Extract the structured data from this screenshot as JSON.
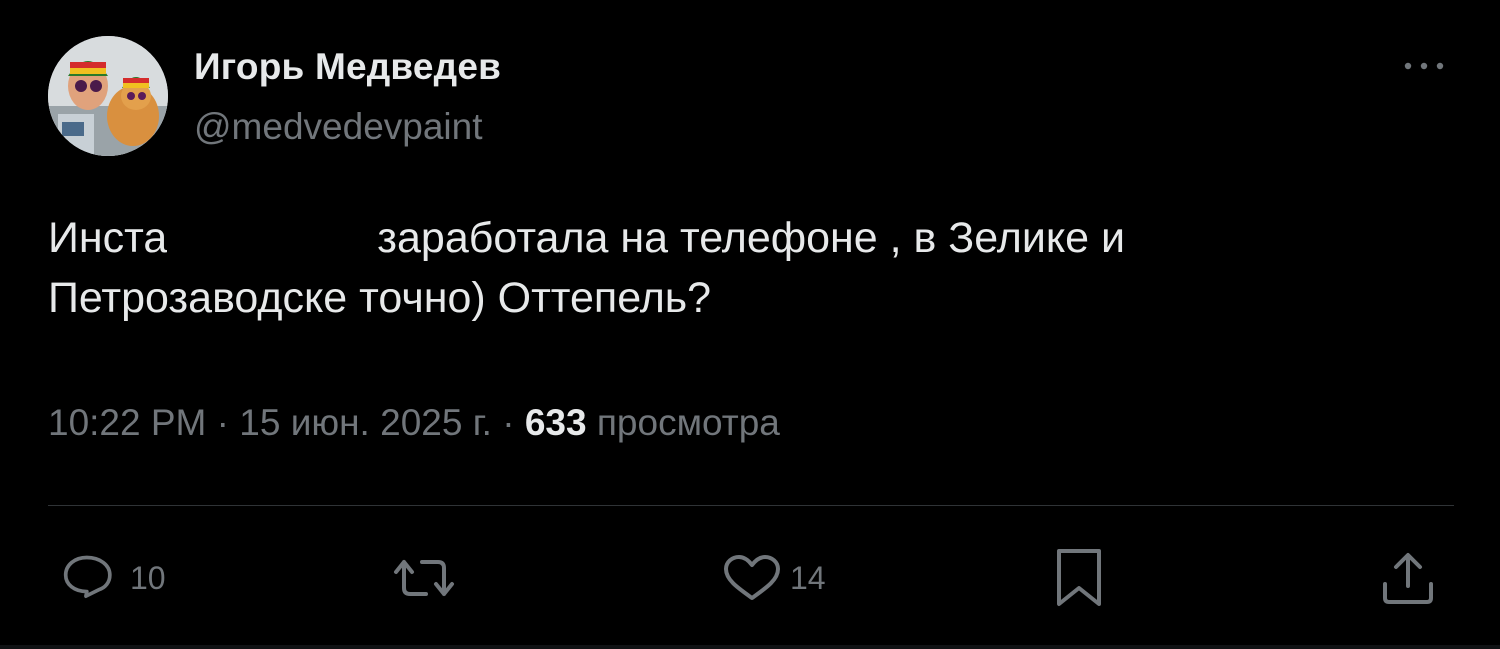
{
  "author": {
    "name": "Игорь Медведев",
    "handle": "@medvedevpaint"
  },
  "tweet": {
    "line1_start": "Инста",
    "line1_end": "заработала на телефоне , в Зелике и",
    "line2": "Петрозаводске точно) Оттепель?"
  },
  "meta": {
    "time": "10:22 PM",
    "separator": "·",
    "date": "15 июн. 2025 г.",
    "views_count": "633",
    "views_label": "просмотра"
  },
  "actions": {
    "reply_count": "10",
    "like_count": "14"
  },
  "icons": {
    "more": "more-horizontal-icon",
    "reply": "reply-icon",
    "retweet": "retweet-icon",
    "like": "heart-icon",
    "bookmark": "bookmark-icon",
    "share": "share-icon"
  },
  "colors": {
    "background": "#000000",
    "primary_text": "#e7e9ea",
    "secondary_text": "#71767b",
    "divider": "#2f3336"
  }
}
